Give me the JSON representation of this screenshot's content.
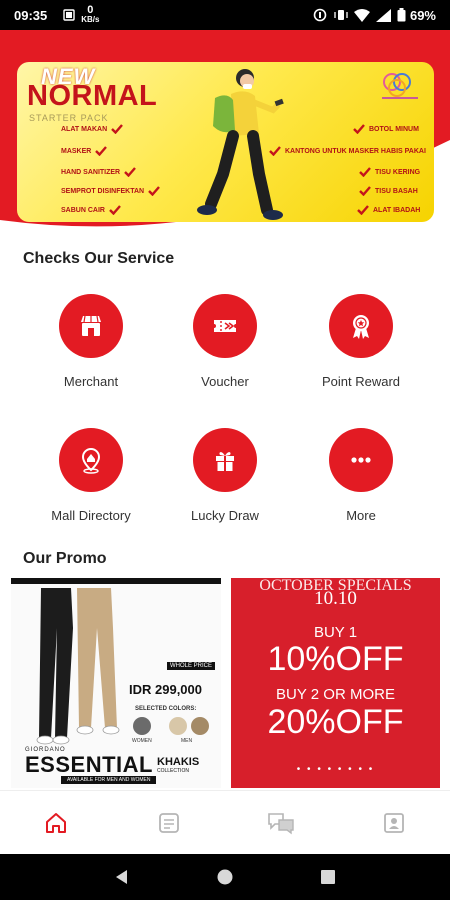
{
  "status_bar": {
    "time": "09:35",
    "data_rate_value": "0",
    "data_rate_unit": "KB/s",
    "battery_percent": "69%"
  },
  "banner": {
    "headline_small": "NEW",
    "headline": "NORMAL",
    "subheadline": "STARTER PACK",
    "items_left": [
      "ALAT MAKAN",
      "MASKER",
      "HAND SANITIZER",
      "SEMPROT DISINFEKTAN",
      "SABUN CAIR"
    ],
    "items_right": [
      "BOTOL MINUM",
      "KANTONG UNTUK MASKER HABIS PAKAI",
      "TISU KERING",
      "TISU BASAH",
      "ALAT IBADAH"
    ],
    "colors": {
      "headline": "#c4141b",
      "check": "#c4141b"
    }
  },
  "services": {
    "title": "Checks Our Service",
    "items": [
      {
        "label": "Merchant",
        "icon": "store-icon"
      },
      {
        "label": "Voucher",
        "icon": "ticket-icon"
      },
      {
        "label": "Point Reward",
        "icon": "award-ribbon-icon"
      },
      {
        "label": "Mall Directory",
        "icon": "map-pin-icon"
      },
      {
        "label": "Lucky Draw",
        "icon": "gift-icon"
      },
      {
        "label": "More",
        "icon": "more-dots-icon"
      }
    ]
  },
  "promo": {
    "title": "Our Promo",
    "cards": [
      {
        "whole_price_label": "WHOLE PRICE",
        "price": "IDR 299,000",
        "selected_colors_label": "SELECTED COLORS:",
        "color_labels": [
          "WOMEN",
          "MEN"
        ],
        "brand": "GIORDANO",
        "headline": "ESSENTIAL",
        "headline_2": "KHAKIS",
        "collection": "COLLECTION",
        "availability": "AVAILABLE FOR MEN AND WOMEN"
      },
      {
        "top_text": "OCTOBER SPECIALS",
        "date": "10.10",
        "offer_1_label": "BUY 1",
        "offer_1_value": "10%OFF",
        "offer_2_label": "BUY 2 OR MORE",
        "offer_2_value": "20%OFF",
        "dots": "• • • • • • • •"
      }
    ]
  },
  "bottom_nav": {
    "tabs": [
      {
        "icon": "home-icon",
        "active": true
      },
      {
        "icon": "document-icon",
        "active": false
      },
      {
        "icon": "chat-icon",
        "active": false
      },
      {
        "icon": "profile-icon",
        "active": false
      }
    ]
  },
  "theme": {
    "primary": "#e31b23",
    "text": "#222222",
    "inactive_icon": "#b5b5b5"
  }
}
